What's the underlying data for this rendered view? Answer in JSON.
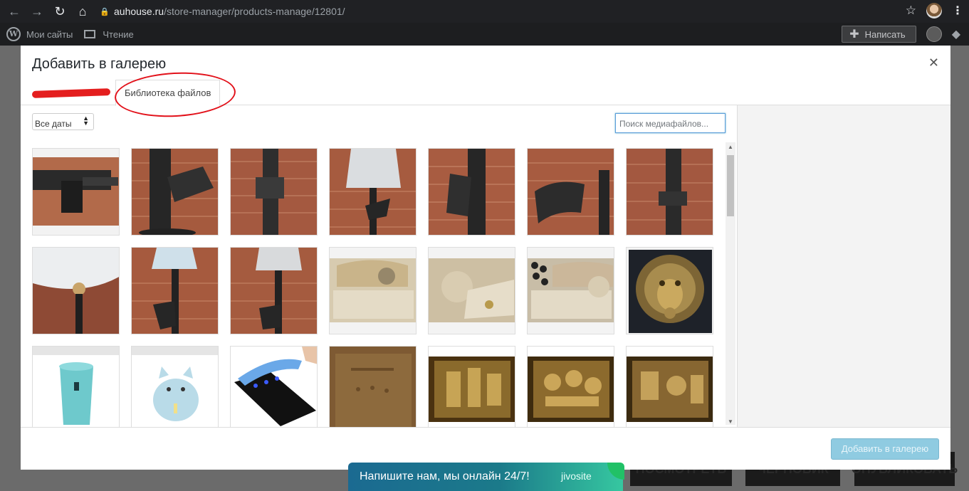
{
  "browser": {
    "url_host": "auhouse.ru",
    "url_path": "/store-manager/products-manage/12801/"
  },
  "adminbar": {
    "sites_label": "Мои сайты",
    "reader_label": "Чтение",
    "write_label": "Написать"
  },
  "background_buttons": [
    "ПОСМОТРЕТЬ",
    "ЧЕРНОВИК",
    "ОПУБЛИКОВАТЬ"
  ],
  "modal": {
    "title": "Добавить в галерею",
    "tab_library": "Библиотека файлов",
    "date_filter": "Все даты",
    "search_placeholder": "Поиск медиафайлов...",
    "add_button": "Добавить в галерею"
  },
  "media": [
    {
      "kind": "rifle-closeup"
    },
    {
      "kind": "rifle-mag-brick"
    },
    {
      "kind": "rifle-brick"
    },
    {
      "kind": "lamp-rifle-shade"
    },
    {
      "kind": "rifle-mag-brick"
    },
    {
      "kind": "mag-brick"
    },
    {
      "kind": "rifle-brick"
    },
    {
      "kind": "lamp-shade-bulb"
    },
    {
      "kind": "lamp-rifle-shade"
    },
    {
      "kind": "lamp-rifle-shade"
    },
    {
      "kind": "carved-panel"
    },
    {
      "kind": "carved-panel"
    },
    {
      "kind": "carved-panel"
    },
    {
      "kind": "lion"
    },
    {
      "kind": "humidifier-blue"
    },
    {
      "kind": "humidifier-cat"
    },
    {
      "kind": "phone-uv"
    },
    {
      "kind": "copper-plate"
    },
    {
      "kind": "bronze-relief"
    },
    {
      "kind": "bronze-relief"
    },
    {
      "kind": "bronze-relief"
    }
  ],
  "chat": {
    "message": "Напишите нам, мы онлайн 24/7!",
    "brand": "jivosite"
  }
}
